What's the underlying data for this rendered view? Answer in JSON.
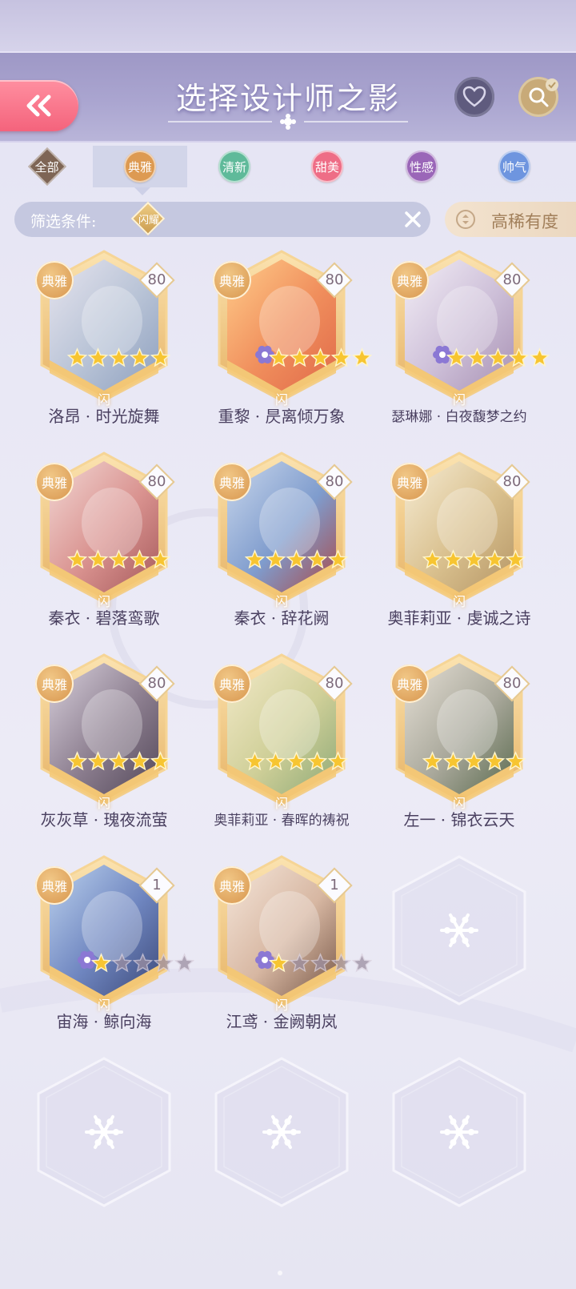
{
  "header": {
    "title": "选择设计师之影"
  },
  "categories": [
    {
      "label": "全部",
      "color": "#7e6555",
      "shape": "diamond",
      "active": false
    },
    {
      "label": "典雅",
      "color": "#dd9a52",
      "shape": "circle",
      "active": true
    },
    {
      "label": "清新",
      "color": "#5fba9a",
      "shape": "circle",
      "active": false
    },
    {
      "label": "甜美",
      "color": "#ee6d86",
      "shape": "circle",
      "active": false
    },
    {
      "label": "性感",
      "color": "#9a66b8",
      "shape": "circle",
      "active": false
    },
    {
      "label": "帅气",
      "color": "#6e95df",
      "shape": "circle",
      "active": false
    }
  ],
  "filter": {
    "label": "筛选条件:",
    "chip": "闪耀"
  },
  "sort": {
    "label": "高稀有度"
  },
  "cards": [
    {
      "name": "洛昂 · 时光旋舞",
      "type": "典雅",
      "level": "80",
      "stars_filled": 5,
      "flower": false,
      "tag": "闪",
      "palette": [
        "#e6e4ee",
        "#b8c3d6",
        "#8ea0bf"
      ]
    },
    {
      "name": "重黎 · 昃离倾万象",
      "type": "典雅",
      "level": "80",
      "stars_filled": 5,
      "flower": true,
      "tag": "闪",
      "palette": [
        "#ffcc8a",
        "#f08e5c",
        "#e06a4a"
      ]
    },
    {
      "name": "瑟琳娜 · 白夜馥梦之约",
      "type": "典雅",
      "level": "80",
      "stars_filled": 5,
      "flower": true,
      "tag": "闪",
      "palette": [
        "#f3eef6",
        "#cdbfd8",
        "#a891b3"
      ],
      "small": true
    },
    {
      "name": "秦衣 · 碧落鸾歌",
      "type": "典雅",
      "level": "80",
      "stars_filled": 5,
      "flower": false,
      "tag": "闪",
      "palette": [
        "#f2d7d4",
        "#d9928f",
        "#a65a5c"
      ]
    },
    {
      "name": "秦衣 · 辞花阙",
      "type": "典雅",
      "level": "80",
      "stars_filled": 5,
      "flower": false,
      "tag": "闪",
      "palette": [
        "#c9d7ec",
        "#7f9ccd",
        "#a94a4a"
      ]
    },
    {
      "name": "奥菲莉亚 · 虔诚之诗",
      "type": "典雅",
      "level": "80",
      "stars_filled": 5,
      "flower": false,
      "tag": "闪",
      "palette": [
        "#f6ecd4",
        "#d9c08e",
        "#b59666"
      ]
    },
    {
      "name": "灰灰草 · 瑰夜流萤",
      "type": "典雅",
      "level": "80",
      "stars_filled": 5,
      "flower": false,
      "tag": "闪",
      "palette": [
        "#d8d0dc",
        "#8c7e8f",
        "#54495a"
      ]
    },
    {
      "name": "奥菲莉亚 · 春晖的祷祝",
      "type": "典雅",
      "level": "80",
      "stars_filled": 5,
      "flower": false,
      "tag": "闪",
      "palette": [
        "#f2e9c8",
        "#cfcf98",
        "#8faa78"
      ],
      "small": true
    },
    {
      "name": "左一 · 锦衣云天",
      "type": "典雅",
      "level": "80",
      "stars_filled": 5,
      "flower": false,
      "tag": "闪",
      "palette": [
        "#e6e0d6",
        "#a9a89b",
        "#5b6b4f"
      ]
    },
    {
      "name": "宙海 · 鲸向海",
      "type": "典雅",
      "level": "1",
      "stars_filled": 1,
      "flower": true,
      "tag": "闪",
      "palette": [
        "#bcd2ee",
        "#6f86c0",
        "#3d4a7a"
      ]
    },
    {
      "name": "江鸢 · 金阙朝岚",
      "type": "典雅",
      "level": "1",
      "stars_filled": 1,
      "flower": true,
      "tag": "闪",
      "palette": [
        "#f5e6da",
        "#d7b7a2",
        "#7a5a4a"
      ]
    }
  ],
  "icons": {
    "back": "double-chevron-left-icon",
    "favorite": "heart-icon",
    "search": "search-icon",
    "clear": "close-icon",
    "sort": "sort-icon",
    "empty": "snowflake-icon",
    "star": "star-icon",
    "flower": "flower-icon"
  }
}
